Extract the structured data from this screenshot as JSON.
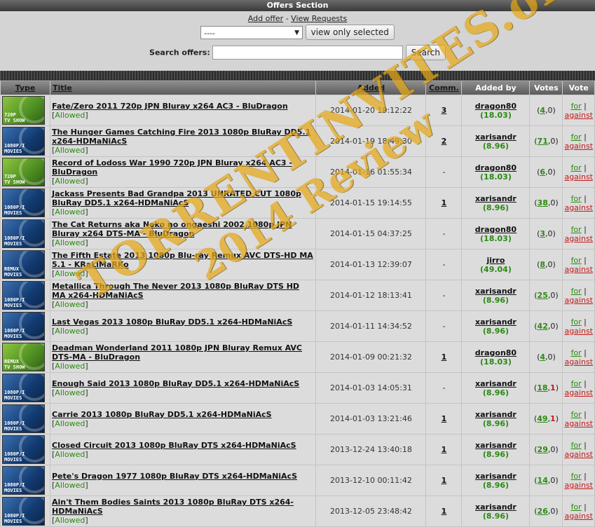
{
  "header": {
    "title": "Offers Section"
  },
  "links": {
    "add_offer": "Add offer",
    "sep": " - ",
    "view_requests": "View Requests"
  },
  "filter": {
    "selected": "----",
    "button": "view only selected"
  },
  "search": {
    "label": "Search offers:",
    "value": "",
    "button": "Search"
  },
  "columns": {
    "type": "Type",
    "title": "Title",
    "added": "Added",
    "comm": "Comm.",
    "added_by": "Added by",
    "votes": "Votes",
    "vote": "Vote"
  },
  "status": {
    "open": "[",
    "allowed": "Allowed",
    "close": "]"
  },
  "vote_labels": {
    "for": "for",
    "sep": " | ",
    "against": "against"
  },
  "watermark": {
    "line1": "TORRENTINVITES.org",
    "line2": "2014 Review"
  },
  "rows": [
    {
      "icon": "720p-tv-show-icon",
      "icon_text": "720P\nTV SHOW",
      "icon_color": "green",
      "title": "Fate/Zero 2011 720p JPN Bluray x264 AC3 - BluDragon",
      "added": "2014-01-20 19:12:22",
      "comm": "3",
      "user": "dragon80",
      "ratio": "(18.03)",
      "up": "4",
      "down": "0"
    },
    {
      "icon": "1080p-movies-icon",
      "icon_text": "1080P/I\nMOVIES",
      "icon_color": "blue",
      "title": "The Hunger Games Catching Fire 2013 1080p BluRay DD5.1 x264-HDMaNiAcS",
      "added": "2014-01-19 18:49:30",
      "comm": "2",
      "user": "xarisandr",
      "ratio": "(8.96)",
      "up": "71",
      "down": "0"
    },
    {
      "icon": "720p-tv-show-icon",
      "icon_text": "720P\nTV SHOW",
      "icon_color": "green",
      "title": "Record of Lodoss War 1990 720p JPN Bluray x264 AC3 - BluDragon",
      "added": "2014-01-16 01:55:34",
      "comm": "-",
      "user": "dragon80",
      "ratio": "(18.03)",
      "up": "6",
      "down": "0"
    },
    {
      "icon": "1080p-movies-icon",
      "icon_text": "1080P/I\nMOVIES",
      "icon_color": "blue",
      "title": "Jackass Presents Bad Grandpa 2013 UNRATED CUT 1080p BluRay DD5.1 x264-HDMaNiAcS",
      "added": "2014-01-15 19:14:55",
      "comm": "1",
      "user": "xarisandr",
      "ratio": "(8.96)",
      "up": "38",
      "down": "0"
    },
    {
      "icon": "1080p-movies-icon",
      "icon_text": "1080P/I\nMOVIES",
      "icon_color": "blue",
      "title": "The Cat Returns aka Neko no ongaeshi 2002 1080p JPN Bluray x264 DTS-MA - BluDragon",
      "added": "2014-01-15 04:37:25",
      "comm": "-",
      "user": "dragon80",
      "ratio": "(18.03)",
      "up": "3",
      "down": "0"
    },
    {
      "icon": "remux-movies-icon",
      "icon_text": "REMUX\nMOVIES",
      "icon_color": "blue",
      "title": "The Fifth Estate 2013 1080p Blu-ray Remux AVC DTS-HD MA 5.1 - KRaLiMaRKo",
      "added": "2014-01-13 12:39:07",
      "comm": "-",
      "user": "jirro",
      "ratio": "(49.04)",
      "up": "8",
      "down": "0"
    },
    {
      "icon": "1080p-movies-icon",
      "icon_text": "1080P/I\nMOVIES",
      "icon_color": "blue",
      "title": "Metallica Through The Never 2013 1080p BluRay DTS HD MA x264-HDMaNiAcS",
      "added": "2014-01-12 18:13:41",
      "comm": "-",
      "user": "xarisandr",
      "ratio": "(8.96)",
      "up": "25",
      "down": "0"
    },
    {
      "icon": "1080p-movies-icon",
      "icon_text": "1080P/I\nMOVIES",
      "icon_color": "blue",
      "title": "Last Vegas 2013 1080p BluRay DD5.1 x264-HDMaNiAcS",
      "added": "2014-01-11 14:34:52",
      "comm": "-",
      "user": "xarisandr",
      "ratio": "(8.96)",
      "up": "42",
      "down": "0"
    },
    {
      "icon": "remux-tv-show-icon",
      "icon_text": "REMUX\nTV SHOW",
      "icon_color": "green",
      "title": "Deadman Wonderland 2011 1080p JPN Bluray Remux AVC DTS-MA - BluDragon",
      "added": "2014-01-09 00:21:32",
      "comm": "1",
      "user": "dragon80",
      "ratio": "(18.03)",
      "up": "4",
      "down": "0"
    },
    {
      "icon": "1080p-movies-icon",
      "icon_text": "1080P/I\nMOVIES",
      "icon_color": "blue",
      "title": "Enough Said 2013 1080p BluRay DD5.1 x264-HDMaNiAcS",
      "added": "2014-01-03 14:05:31",
      "comm": "-",
      "user": "xarisandr",
      "ratio": "(8.96)",
      "up": "18",
      "down": "1"
    },
    {
      "icon": "1080p-movies-icon",
      "icon_text": "1080P/I\nMOVIES",
      "icon_color": "blue",
      "title": "Carrie 2013 1080p BluRay DD5.1 x264-HDMaNiAcS",
      "added": "2014-01-03 13:21:46",
      "comm": "1",
      "user": "xarisandr",
      "ratio": "(8.96)",
      "up": "49",
      "down": "1"
    },
    {
      "icon": "1080p-movies-icon",
      "icon_text": "1080P/I\nMOVIES",
      "icon_color": "blue",
      "title": "Closed Circuit 2013 1080p BluRay DTS x264-HDMaNiAcS",
      "added": "2013-12-24 13:40:18",
      "comm": "1",
      "user": "xarisandr",
      "ratio": "(8.96)",
      "up": "29",
      "down": "0"
    },
    {
      "icon": "1080p-movies-icon",
      "icon_text": "1080P/I\nMOVIES",
      "icon_color": "blue",
      "title": "Pete's Dragon 1977 1080p BluRay DTS x264-HDMaNiAcS",
      "added": "2013-12-10 00:11:42",
      "comm": "1",
      "user": "xarisandr",
      "ratio": "(8.96)",
      "up": "14",
      "down": "0"
    },
    {
      "icon": "1080p-movies-icon",
      "icon_text": "1080P/I\nMOVIES",
      "icon_color": "blue",
      "title": "Ain't Them Bodies Saints 2013 1080p BluRay DTS x264-HDMaNiAcS",
      "added": "2013-12-05 23:48:42",
      "comm": "1",
      "user": "xarisandr",
      "ratio": "(8.96)",
      "up": "26",
      "down": "0"
    }
  ]
}
